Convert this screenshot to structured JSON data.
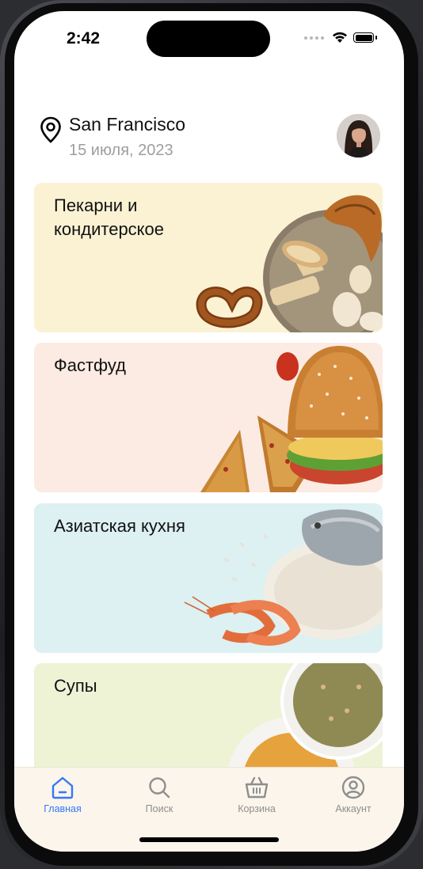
{
  "status_bar": {
    "time": "2:42"
  },
  "header": {
    "city": "San Francisco",
    "date": "15 июля, 2023"
  },
  "categories": [
    {
      "title": "Пекарни и кондитерское",
      "bg": "#fbf2d3",
      "art": "bakery"
    },
    {
      "title": "Фастфуд",
      "bg": "#fbebe3",
      "art": "fastfood"
    },
    {
      "title": "Азиатская кухня",
      "bg": "#ddf0f2",
      "art": "asian"
    },
    {
      "title": "Супы",
      "bg": "#eef3d6",
      "art": "soups"
    }
  ],
  "tabbar": {
    "items": [
      {
        "label": "Главная",
        "icon": "home-icon",
        "active": true
      },
      {
        "label": "Поиск",
        "icon": "search-icon",
        "active": false
      },
      {
        "label": "Корзина",
        "icon": "basket-icon",
        "active": false
      },
      {
        "label": "Аккаунт",
        "icon": "account-icon",
        "active": false
      }
    ]
  },
  "colors": {
    "accent": "#3478f6",
    "inactive": "#8e8e8e"
  }
}
